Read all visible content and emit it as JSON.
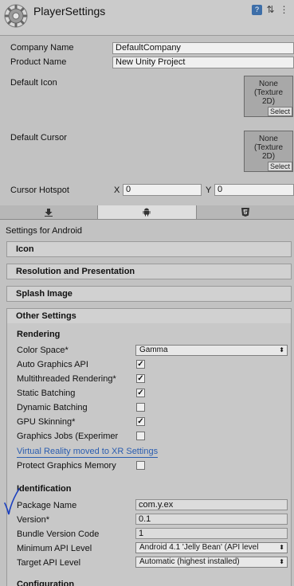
{
  "header": {
    "title": "PlayerSettings",
    "tools": [
      "book-icon",
      "sliders-icon",
      "menu-icon"
    ]
  },
  "player": {
    "company_label": "Company Name",
    "company_value": "DefaultCompany",
    "product_label": "Product Name",
    "product_value": "New Unity Project",
    "default_icon_label": "Default Icon",
    "default_cursor_label": "Default Cursor",
    "texture_text": [
      "None",
      "(Texture",
      "2D)"
    ],
    "select_label": "Select",
    "hotspot_label": "Cursor Hotspot",
    "hotspot_x_label": "X",
    "hotspot_x": "0",
    "hotspot_y_label": "Y",
    "hotspot_y": "0"
  },
  "tabs": [
    "download-icon",
    "android-icon",
    "html5-icon"
  ],
  "settings_for": "Settings for Android",
  "sections": [
    "Icon",
    "Resolution and Presentation",
    "Splash Image",
    "Other Settings"
  ],
  "rendering": {
    "heading": "Rendering",
    "color_space_label": "Color Space*",
    "color_space_value": "Gamma",
    "toggles": [
      {
        "label": "Auto Graphics API",
        "checked": true
      },
      {
        "label": "Multithreaded Rendering*",
        "checked": true
      },
      {
        "label": "Static Batching",
        "checked": true
      },
      {
        "label": "Dynamic Batching",
        "checked": false
      },
      {
        "label": "GPU Skinning*",
        "checked": true
      },
      {
        "label": "Graphics Jobs (Experimer",
        "checked": false
      }
    ],
    "vr_link": "Virtual Reality moved to XR Settings",
    "protect_label": "Protect Graphics Memory",
    "protect_checked": false
  },
  "identification": {
    "heading": "Identification",
    "package_label": "Package Name",
    "package_value": "com.y.ex",
    "version_label": "Version*",
    "version_value": "0.1",
    "bundle_label": "Bundle Version Code",
    "bundle_value": "1",
    "min_api_label": "Minimum API Level",
    "min_api_value": "Android 4.1 'Jelly Bean' (API level",
    "target_api_label": "Target API Level",
    "target_api_value": "Automatic (highest installed)"
  },
  "next_heading": "Configuration",
  "colors": {
    "link": "#2a5db0",
    "annotation": "#1a3fbf"
  }
}
